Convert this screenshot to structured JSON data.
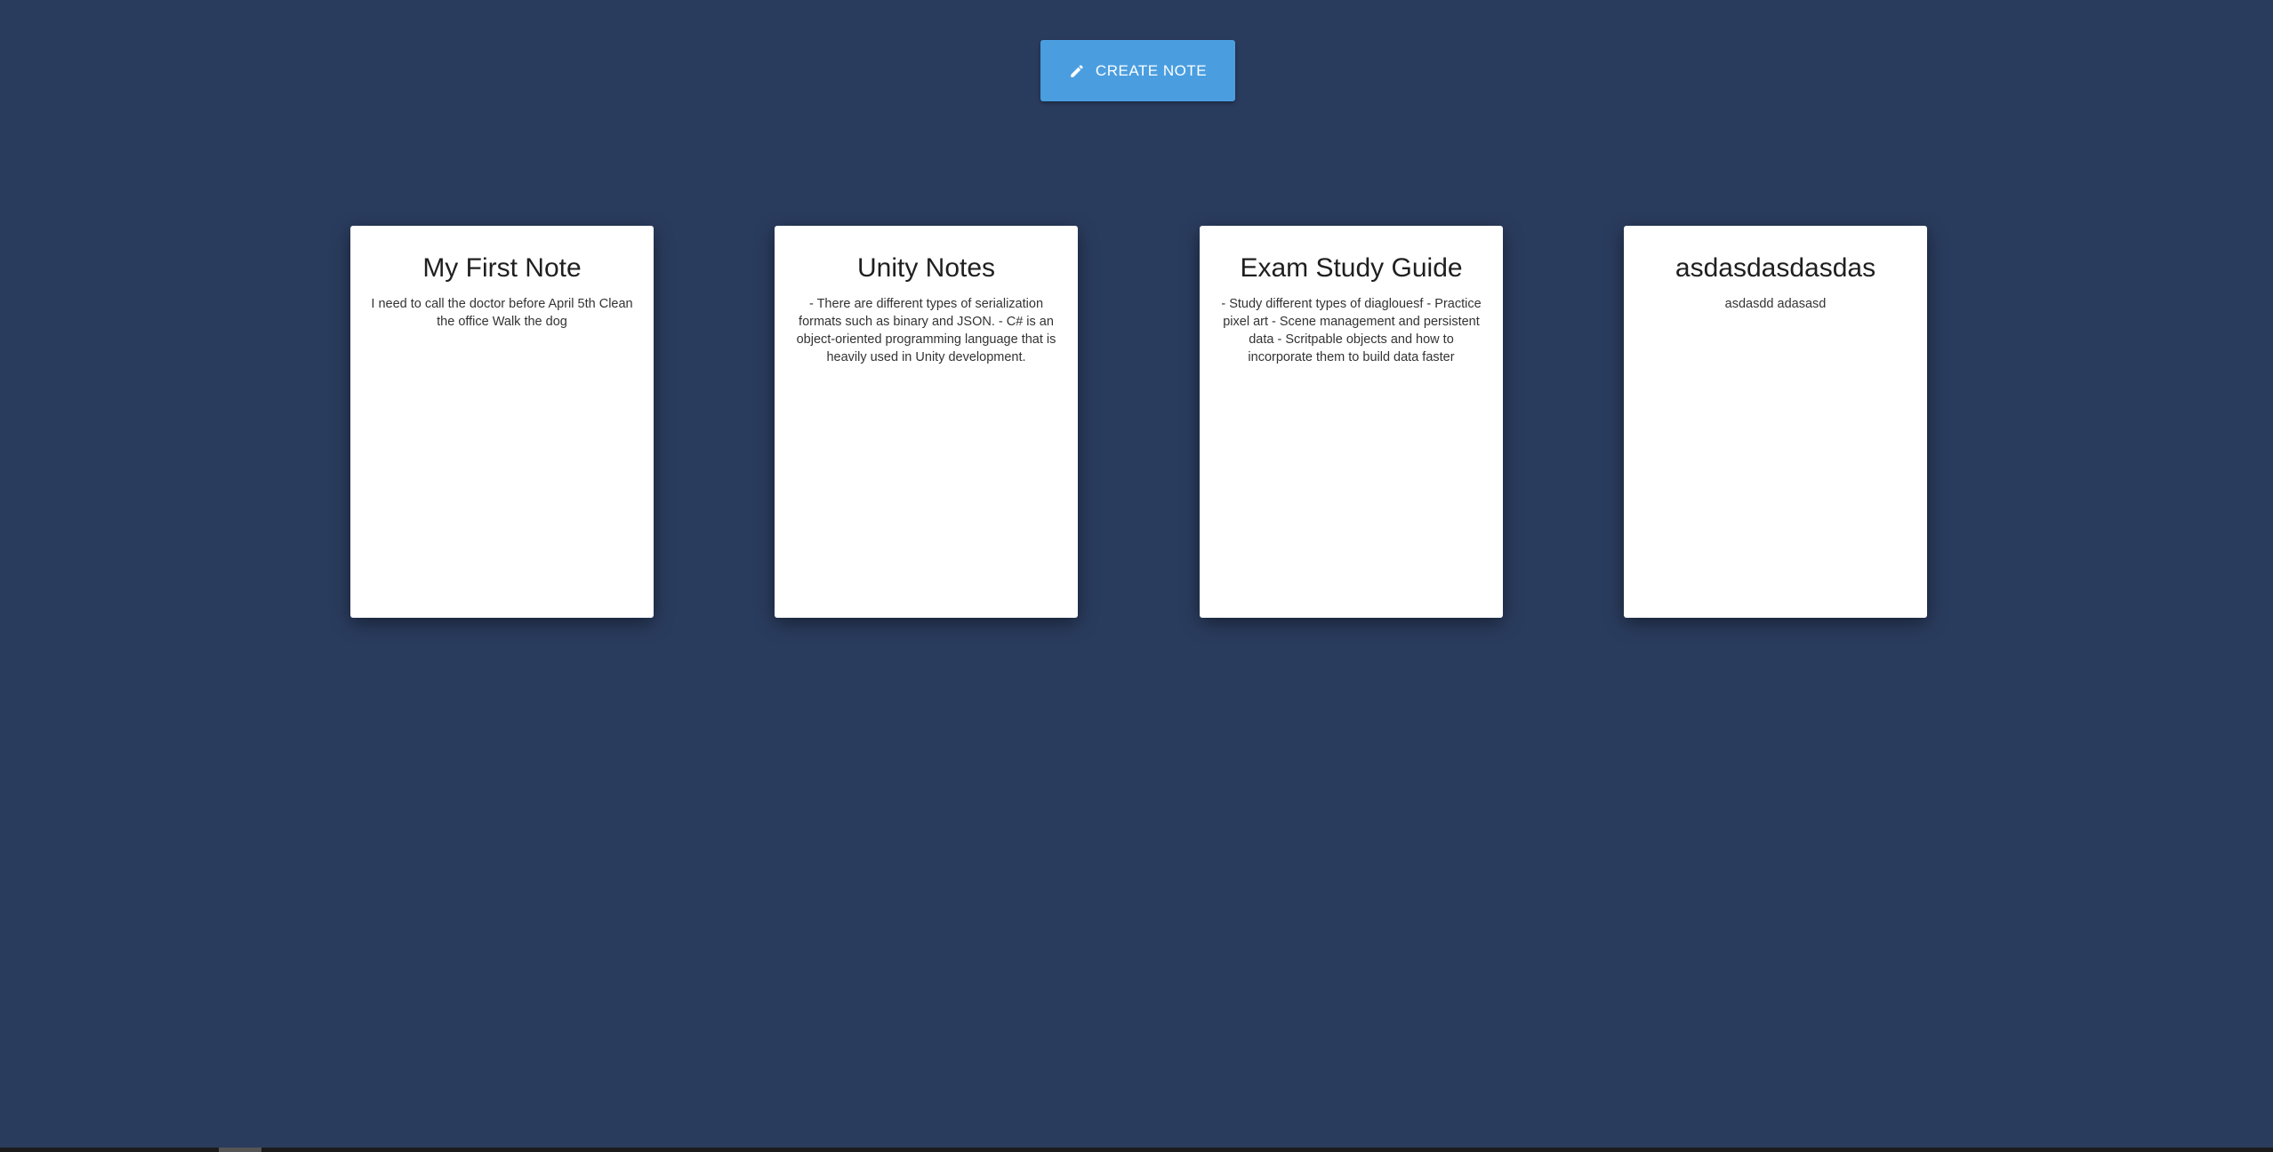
{
  "toolbar": {
    "create_label": "CREATE NOTE",
    "create_icon": "pencil-icon",
    "button_color": "#4a9ee0"
  },
  "theme": {
    "background": "#2a3c5e",
    "card_background": "#ffffff"
  },
  "notes": [
    {
      "title": "My First Note",
      "body": "I need to call the doctor before April 5th Clean the office Walk the dog"
    },
    {
      "title": "Unity Notes",
      "body": "- There are different types of serialization formats such as binary and JSON. - C# is an object-oriented programming language that is heavily used in Unity development."
    },
    {
      "title": "Exam Study Guide",
      "body": "- Study different types of diaglouesf - Practice pixel art - Scene management and persistent data - Scritpable objects and how to incorporate them to build data faster"
    },
    {
      "title": "asdasdasdasdas",
      "body": "asdasdd adasasd"
    }
  ]
}
